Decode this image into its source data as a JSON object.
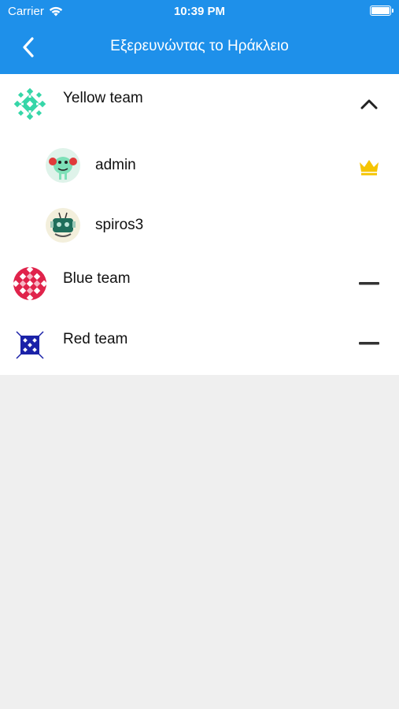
{
  "status_bar": {
    "carrier": "Carrier",
    "time": "10:39 PM"
  },
  "nav": {
    "title": "Εξερευνώντας το Ηράκλειο",
    "back_icon": "chevron-left-icon"
  },
  "colors": {
    "header": "#1e90ea",
    "crown": "#f5c400",
    "yellow_team": "#36d6a8",
    "blue_team": "#e0234b",
    "red_team": "#1b22a8"
  },
  "teams": [
    {
      "name": "Yellow team",
      "expanded": true,
      "toggle_icon": "chevron-up-icon",
      "members": [
        {
          "name": "admin",
          "is_leader": true,
          "badge_icon": "crown-icon"
        },
        {
          "name": "spiros3",
          "is_leader": false
        }
      ]
    },
    {
      "name": "Blue team",
      "expanded": false,
      "toggle_icon": "minus-icon"
    },
    {
      "name": "Red team",
      "expanded": false,
      "toggle_icon": "minus-icon"
    }
  ]
}
